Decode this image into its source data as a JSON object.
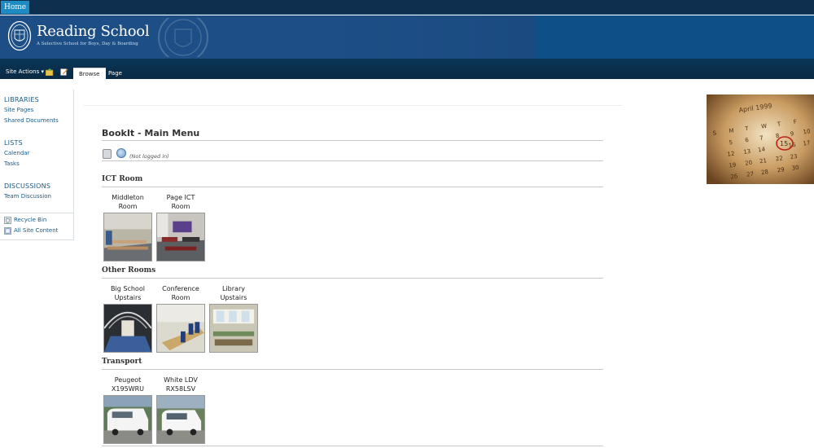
{
  "topbar": {
    "home_label": "Home"
  },
  "banner": {
    "school_name": "Reading School",
    "tagline": "A Selective School for Boys, Day & Boarding"
  },
  "ribbon": {
    "site_actions": "Site Actions",
    "tabs": [
      "Browse",
      "Page"
    ]
  },
  "leftnav": {
    "libraries": {
      "heading": "LIBRARIES",
      "items": [
        "Site Pages",
        "Shared Documents"
      ]
    },
    "lists": {
      "heading": "LISTS",
      "items": [
        "Calendar",
        "Tasks"
      ]
    },
    "discussions": {
      "heading": "DISCUSSIONS",
      "items": [
        "Team Discussion"
      ]
    },
    "footer": [
      "Recycle Bin",
      "All Site Content"
    ]
  },
  "main": {
    "title": "BookIt - Main Menu",
    "status": "(Not logged in)",
    "sections": [
      {
        "name": "ICT Room",
        "rooms": [
          {
            "l1": "Middleton",
            "l2": "Room"
          },
          {
            "l1": "Page ICT",
            "l2": "Room"
          }
        ]
      },
      {
        "name": "Other Rooms",
        "rooms": [
          {
            "l1": "Big School",
            "l2": "Upstairs"
          },
          {
            "l1": "Conference",
            "l2": "Room"
          },
          {
            "l1": "Library",
            "l2": "Upstairs"
          }
        ]
      },
      {
        "name": "Transport",
        "rooms": [
          {
            "l1": "Peugeot",
            "l2": "X195WRU"
          },
          {
            "l1": "White LDV",
            "l2": "RX58LSV"
          }
        ]
      }
    ]
  },
  "calendar_photo": {
    "month": "April 1999",
    "circled_date": "15"
  },
  "colors": {
    "banner": "#1d4f86",
    "ribbon": "#0b3556",
    "home_tab": "#1e8bc3",
    "nav_link": "#1a5a89"
  }
}
